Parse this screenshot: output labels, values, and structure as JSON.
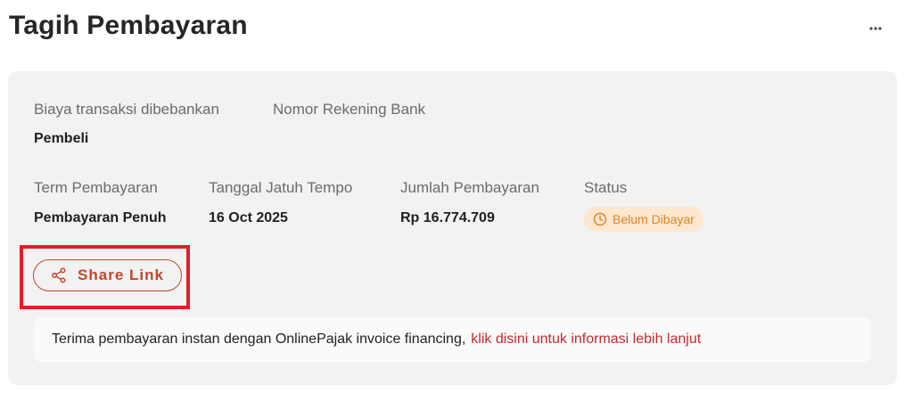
{
  "header": {
    "title": "Tagih Pembayaran",
    "more_icon": "ellipsis-horizontal-icon"
  },
  "card": {
    "fee_label": "Biaya transaksi dibebankan",
    "fee_value": "Pembeli",
    "account_label": "Nomor Rekening Bank",
    "term_label": "Term Pembayaran",
    "term_value": "Pembayaran Penuh",
    "due_label": "Tanggal Jatuh Tempo",
    "due_value": "16 Oct 2025",
    "amount_label": "Jumlah Pembayaran",
    "amount_value": "Rp 16.774.709",
    "status_label": "Status",
    "status_value": "Belum Dibayar",
    "status_icon": "clock-icon",
    "share_label": "Share Link",
    "share_icon": "share-icon",
    "banner_text": "Terima pembayaran instan dengan OnlinePajak invoice financing,",
    "banner_link": "klik disini untuk informasi lebih lanjut"
  },
  "colors": {
    "accent": "#c2462c",
    "highlight": "#e11e26",
    "status_bg": "#fde7cf",
    "status_text": "#d98526",
    "link": "#c22b2b",
    "card_bg": "#f2f2f2"
  }
}
